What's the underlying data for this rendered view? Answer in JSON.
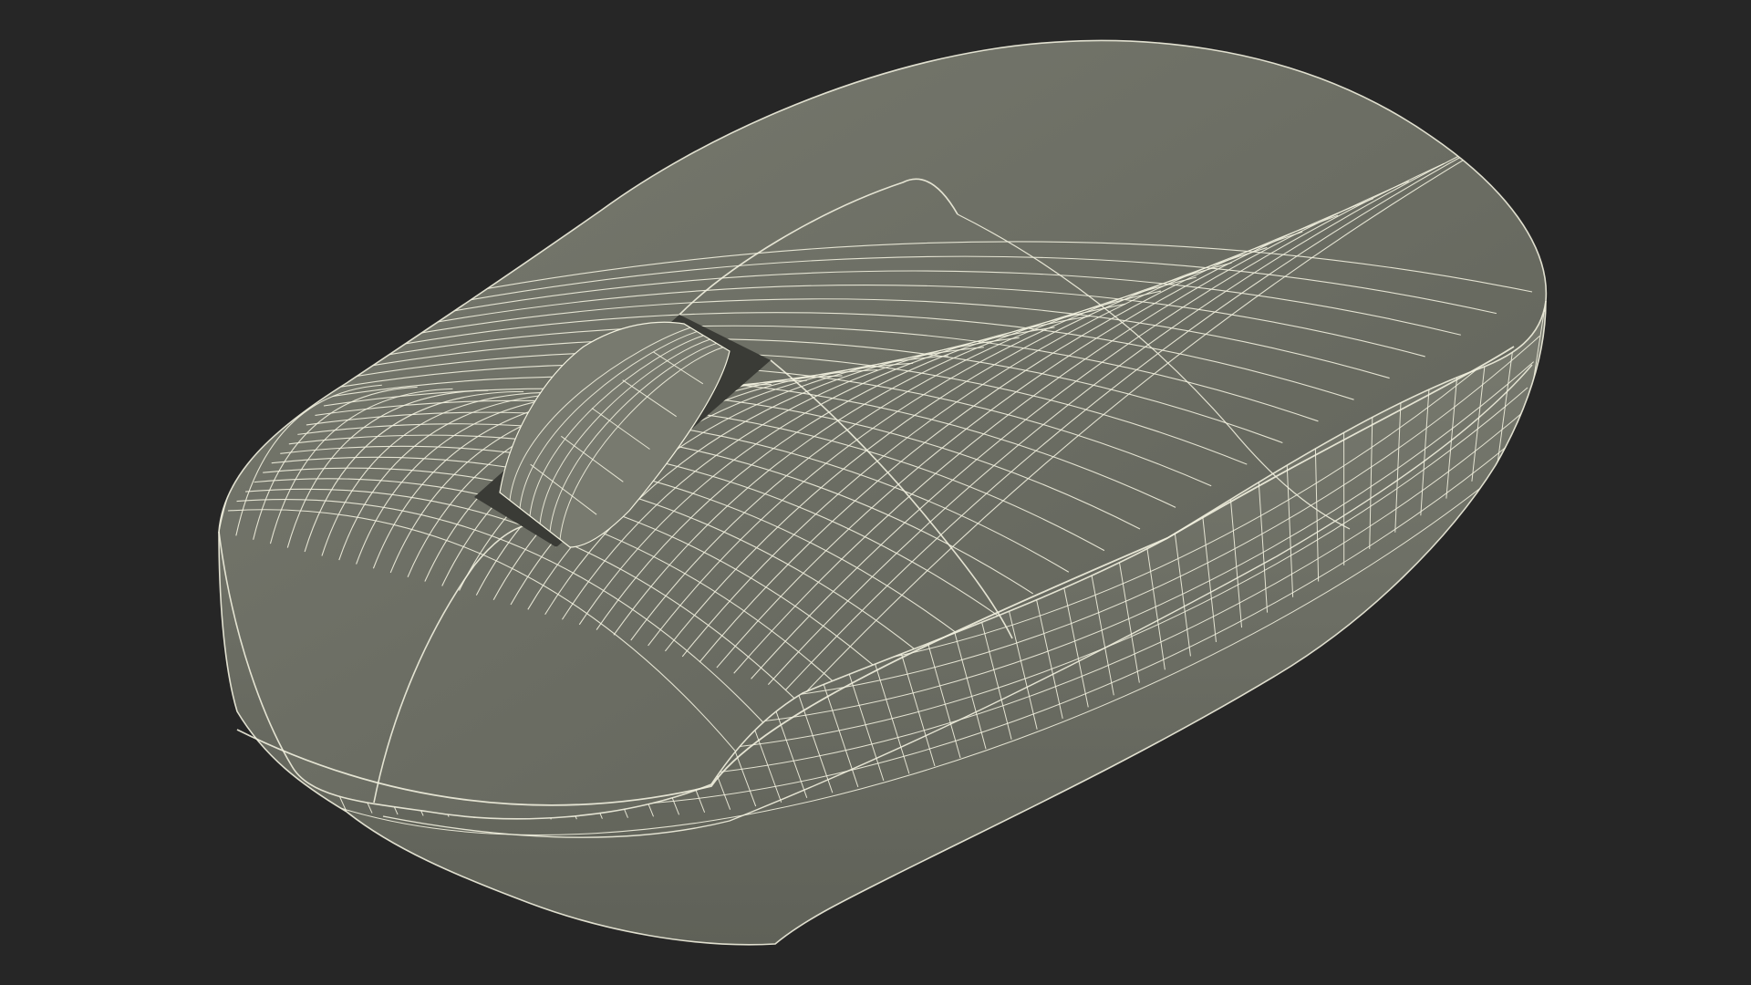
{
  "scene": {
    "background_color": "#262626",
    "surface_color": "#787a6f",
    "surface_shadow_color": "#5f6158",
    "wire_color": "#f2f1df",
    "dark_slot_color": "#3a3b36"
  },
  "model": {
    "icon": "computer-mouse-wireframe"
  }
}
